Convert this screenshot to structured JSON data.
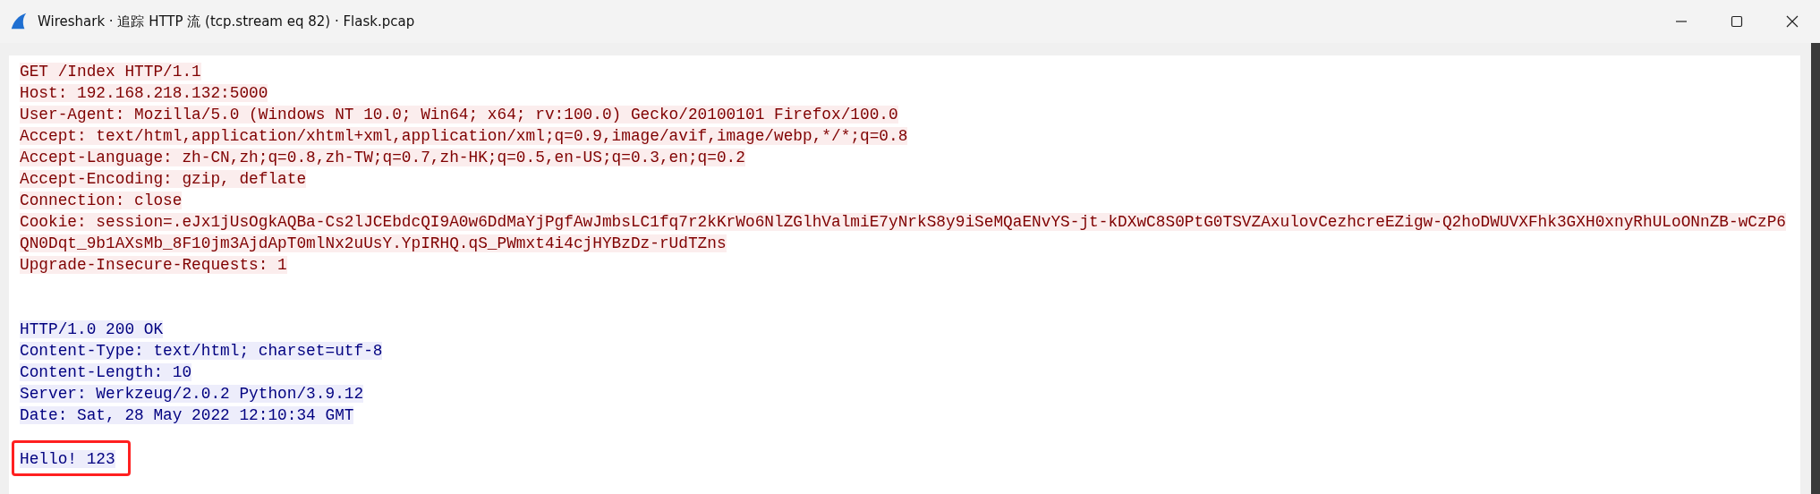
{
  "window": {
    "title": "Wireshark · 追踪 HTTP 流 (tcp.stream eq 82) · Flask.pcap"
  },
  "segments": [
    {
      "kind": "request",
      "marked": false,
      "lines": [
        "GET /Index HTTP/1.1",
        "Host: 192.168.218.132:5000",
        "User-Agent: Mozilla/5.0 (Windows NT 10.0; Win64; x64; rv:100.0) Gecko/20100101 Firefox/100.0",
        "Accept: text/html,application/xhtml+xml,application/xml;q=0.9,image/avif,image/webp,*/*;q=0.8",
        "Accept-Language: zh-CN,zh;q=0.8,zh-TW;q=0.7,zh-HK;q=0.5,en-US;q=0.3,en;q=0.2",
        "Accept-Encoding: gzip, deflate",
        "Connection: close",
        "Cookie: session=.eJx1jUsOgkAQBa-Cs2lJCEbdcQI9A0w6DdMaYjPgfAwJmbsLC1fq7r2kKrWo6NlZGlhValmiE7yNrkS8y9iSeMQaENvYS-jt-kDXwC8S0PtG0TSVZAxulovCezhcreEZigw-Q2hoDWUVXFhk3GXH0xnyRhULoONnZB-wCzP6",
        "QN0Dqt_9b1AXsMb_8F10jm3AjdApT0mlNx2uUsY.YpIRHQ.qS_PWmxt4i4cjHYBzDz-rUdTZns",
        "Upgrade-Insecure-Requests: 1"
      ]
    },
    {
      "kind": "response",
      "marked": false,
      "lines": [
        "HTTP/1.0 200 OK",
        "Content-Type: text/html; charset=utf-8",
        "Content-Length: 10",
        "Server: Werkzeug/2.0.2 Python/3.9.12",
        "Date: Sat, 28 May 2022 12:10:34 GMT"
      ]
    },
    {
      "kind": "body",
      "marked": true,
      "lines": [
        "Hello! 123"
      ]
    }
  ]
}
